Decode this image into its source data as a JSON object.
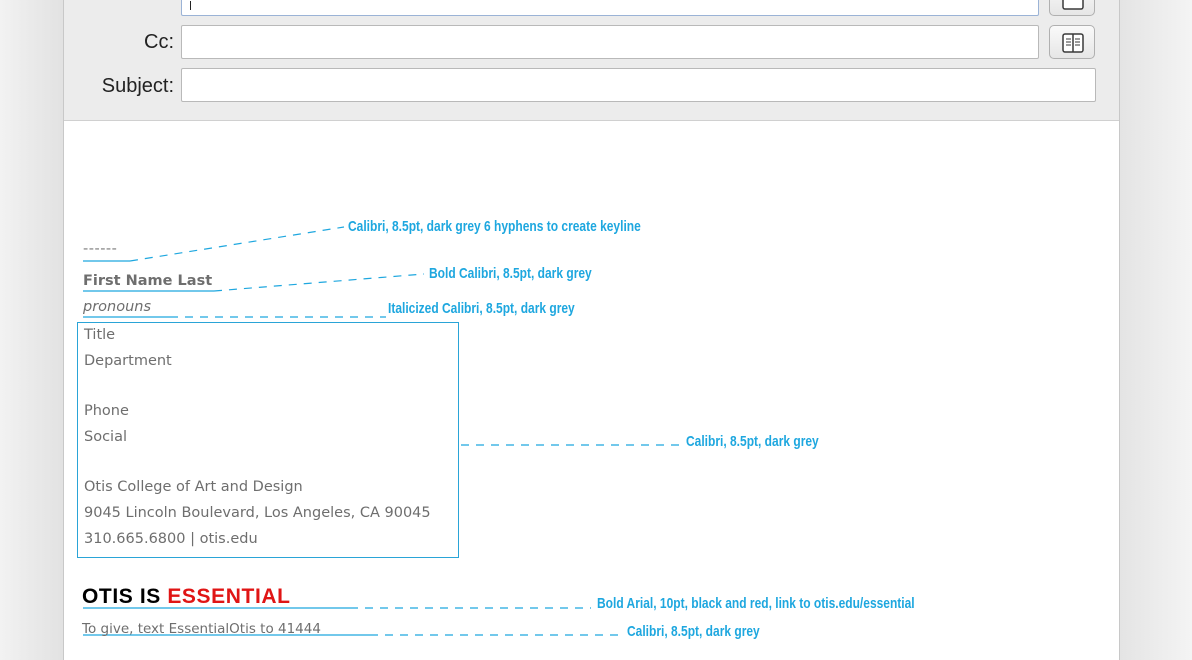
{
  "fields": {
    "cc_label": "Cc:",
    "subject_label": "Subject:",
    "to_value": "",
    "cc_value": "",
    "subject_value": ""
  },
  "signature": {
    "hyphens": "------",
    "name": "First Name Last",
    "pronouns": "pronouns",
    "lines": [
      "Title",
      "Department",
      "",
      "Phone",
      "Social",
      "",
      "Otis College of Art and Design",
      "9045 Lincoln Boulevard, Los Angeles, CA 90045",
      "310.665.6800  |  otis.edu"
    ],
    "banner_black": "OTIS IS ",
    "banner_red": "ESSENTIAL",
    "give_text": "To give, text EssentialOtis to 41444"
  },
  "annotations": {
    "hyphens": "Calibri, 8.5pt, dark grey 6 hyphens to create keyline",
    "name": "Bold Calibri, 8.5pt, dark grey",
    "pronouns": "Italicized Calibri, 8.5pt, dark grey",
    "block": "Calibri, 8.5pt, dark grey",
    "banner": "Bold Arial, 10pt, black and red, link to otis.edu/essential",
    "give": "Calibri, 8.5pt, dark grey"
  },
  "icons": {
    "address_book": "address-book-icon"
  },
  "colors": {
    "annotation": "#1ea7df",
    "signature_text": "#6e6e6e",
    "banner_red": "#e01515",
    "banner_black": "#000000"
  }
}
